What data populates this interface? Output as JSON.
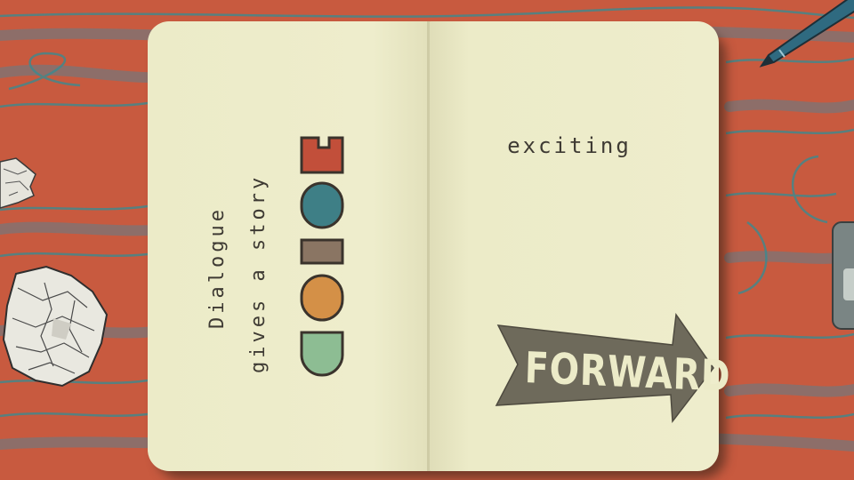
{
  "left_page": {
    "line1": "Dialogue",
    "line2": "gives a story",
    "color_word_label": "color"
  },
  "right_page": {
    "top_word": "exciting",
    "arrow_word": "FORWARD"
  },
  "colors": {
    "desk": "#c85a3f",
    "paper": "#ecebc8",
    "ink": "#3e3a33",
    "red_block": "#c24f3a",
    "teal_block": "#3e7f86",
    "brown_block": "#8a7563",
    "orange_block": "#d49047",
    "green_block": "#8dbd93",
    "arrow": "#6e6a5b"
  },
  "icons": [
    "pen-icon",
    "crumpled-paper-icon",
    "calculator-icon"
  ]
}
